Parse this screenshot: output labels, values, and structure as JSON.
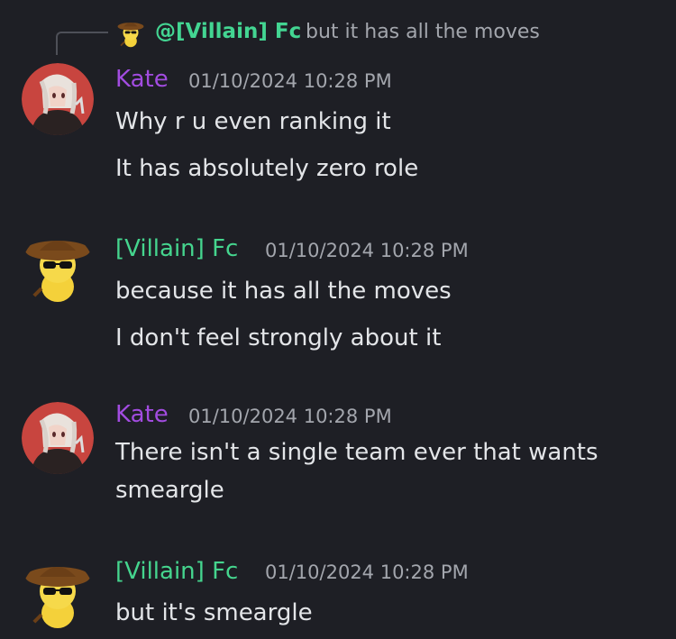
{
  "reply": {
    "author": "@[Villain] Fc",
    "text": "but it has all the moves"
  },
  "messages": [
    {
      "author": "Kate",
      "timestamp": "01/10/2024 10:28 PM",
      "lines": [
        "Why r u even ranking it",
        "It has absolutely zero role"
      ]
    },
    {
      "author": "[Villain] Fc",
      "timestamp": "01/10/2024 10:28 PM",
      "lines": [
        "because it has all the moves",
        "I don't feel strongly about it"
      ]
    },
    {
      "author": "Kate",
      "timestamp": "01/10/2024 10:28 PM",
      "lines": [
        "There isn't a single team ever that wants",
        "smeargle"
      ]
    },
    {
      "author": "[Villain] Fc",
      "timestamp": "01/10/2024 10:28 PM",
      "lines": [
        "but it's smeargle"
      ]
    }
  ],
  "colors": {
    "background": "#1e1f25",
    "kate_name": "#a24ce0",
    "fc_name": "#45d58e",
    "reply_author": "#43d592",
    "timestamp": "#a3a6ad",
    "message_text": "#e3e5e8"
  },
  "icons": {
    "kate_avatar": "anime-girl-avatar",
    "fc_avatar": "yellow-creature-with-hat-and-sunglasses-avatar"
  }
}
